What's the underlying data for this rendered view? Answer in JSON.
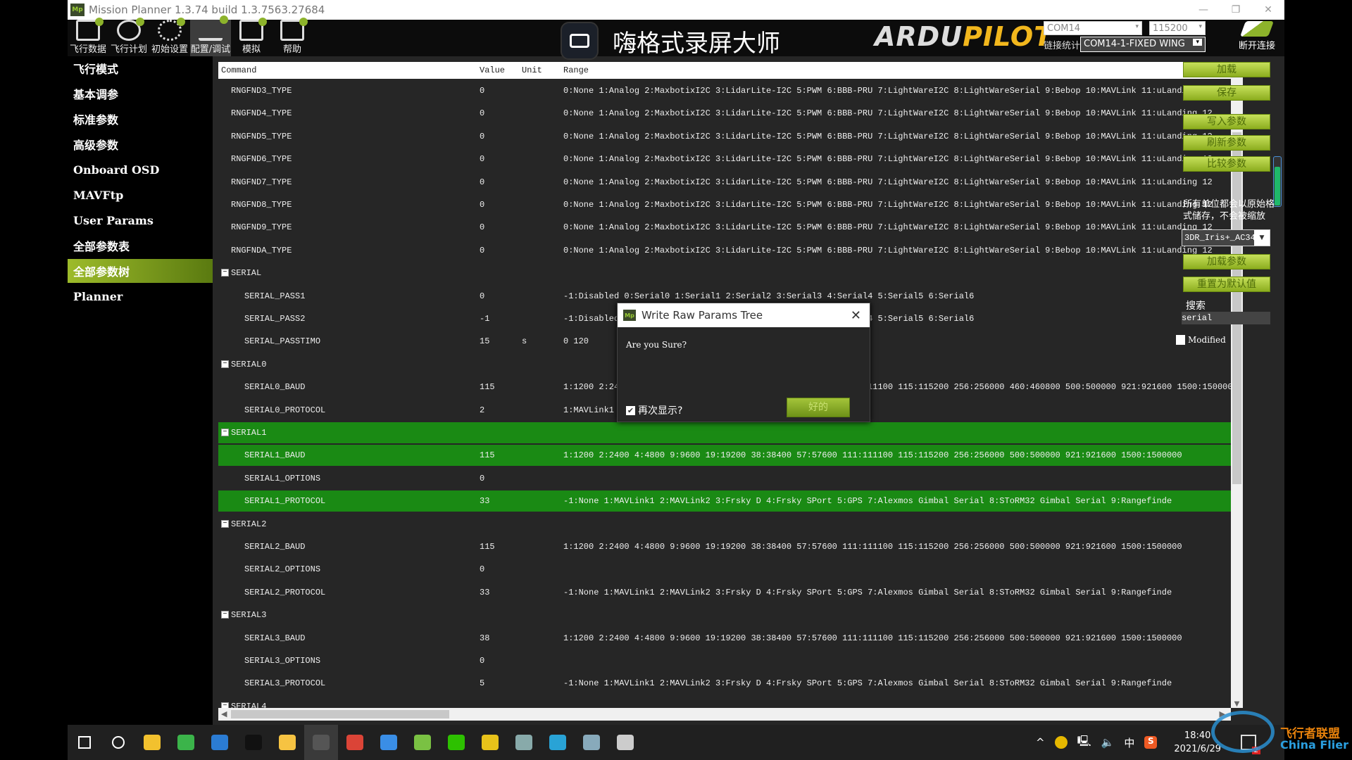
{
  "window": {
    "title": "Mission Planner 1.3.74 build 1.3.7563.27684",
    "logo": "Mp"
  },
  "toolbar": {
    "items": [
      {
        "label": "飞行数据",
        "icon": "flight-data-icon"
      },
      {
        "label": "飞行计划",
        "icon": "flight-plan-icon"
      },
      {
        "label": "初始设置",
        "icon": "initial-setup-icon"
      },
      {
        "label": "配置/调试",
        "icon": "config-tuning-icon",
        "selected": true
      },
      {
        "label": "模拟",
        "icon": "simulation-icon"
      },
      {
        "label": "帮助",
        "icon": "help-icon"
      }
    ],
    "recorder_overlay": "嗨格式录屏大师",
    "logo_ardu": "ARDU",
    "logo_pilot": "PILOT",
    "port": "COM14",
    "baud": "115200",
    "link_stats": "链接统计",
    "connection": "COM14-1-FIXED WING",
    "disconnect": "断开连接"
  },
  "sidebar": {
    "items": [
      {
        "label": "飞行模式"
      },
      {
        "label": "基本调参"
      },
      {
        "label": "标准参数"
      },
      {
        "label": "高级参数"
      },
      {
        "label": "Onboard OSD"
      },
      {
        "label": "MAVFtp"
      },
      {
        "label": "User Params"
      },
      {
        "label": "全部参数表"
      },
      {
        "label": "全部参数树",
        "active": true
      },
      {
        "label": "Planner"
      }
    ]
  },
  "grid": {
    "columns": [
      "Command",
      "Value",
      "Unit",
      "Range"
    ],
    "highlight_color": "#1a8a14",
    "rows": [
      {
        "level": 1,
        "name": "RNGFND3_TYPE",
        "value": "0",
        "unit": "",
        "range": "0:None 1:Analog 2:MaxbotixI2C 3:LidarLite-I2C 5:PWM 6:BBB-PRU 7:LightWareI2C 8:LightWareSerial 9:Bebop 10:MAVLink 11:uLanding 12"
      },
      {
        "level": 1,
        "name": "RNGFND4_TYPE",
        "value": "0",
        "unit": "",
        "range": "0:None 1:Analog 2:MaxbotixI2C 3:LidarLite-I2C 5:PWM 6:BBB-PRU 7:LightWareI2C 8:LightWareSerial 9:Bebop 10:MAVLink 11:uLanding 12"
      },
      {
        "level": 1,
        "name": "RNGFND5_TYPE",
        "value": "0",
        "unit": "",
        "range": "0:None 1:Analog 2:MaxbotixI2C 3:LidarLite-I2C 5:PWM 6:BBB-PRU 7:LightWareI2C 8:LightWareSerial 9:Bebop 10:MAVLink 11:uLanding 12"
      },
      {
        "level": 1,
        "name": "RNGFND6_TYPE",
        "value": "0",
        "unit": "",
        "range": "0:None 1:Analog 2:MaxbotixI2C 3:LidarLite-I2C 5:PWM 6:BBB-PRU 7:LightWareI2C 8:LightWareSerial 9:Bebop 10:MAVLink 11:uLanding 12"
      },
      {
        "level": 1,
        "name": "RNGFND7_TYPE",
        "value": "0",
        "unit": "",
        "range": "0:None 1:Analog 2:MaxbotixI2C 3:LidarLite-I2C 5:PWM 6:BBB-PRU 7:LightWareI2C 8:LightWareSerial 9:Bebop 10:MAVLink 11:uLanding 12"
      },
      {
        "level": 1,
        "name": "RNGFND8_TYPE",
        "value": "0",
        "unit": "",
        "range": "0:None 1:Analog 2:MaxbotixI2C 3:LidarLite-I2C 5:PWM 6:BBB-PRU 7:LightWareI2C 8:LightWareSerial 9:Bebop 10:MAVLink 11:uLanding 12"
      },
      {
        "level": 1,
        "name": "RNGFND9_TYPE",
        "value": "0",
        "unit": "",
        "range": "0:None 1:Analog 2:MaxbotixI2C 3:LidarLite-I2C 5:PWM 6:BBB-PRU 7:LightWareI2C 8:LightWareSerial 9:Bebop 10:MAVLink 11:uLanding 12"
      },
      {
        "level": 1,
        "name": "RNGFNDA_TYPE",
        "value": "0",
        "unit": "",
        "range": "0:None 1:Analog 2:MaxbotixI2C 3:LidarLite-I2C 5:PWM 6:BBB-PRU 7:LightWareI2C 8:LightWareSerial 9:Bebop 10:MAVLink 11:uLanding 12"
      },
      {
        "level": 0,
        "group": true,
        "name": "SERIAL"
      },
      {
        "level": 2,
        "name": "SERIAL_PASS1",
        "value": "0",
        "unit": "",
        "range": "-1:Disabled 0:Serial0 1:Serial1 2:Serial2 3:Serial3 4:Serial4 5:Serial5 6:Serial6"
      },
      {
        "level": 2,
        "name": "SERIAL_PASS2",
        "value": "-1",
        "unit": "",
        "range": "-1:Disabled 0:Serial0 1:Serial1 2:Serial2 3:Serial3 4:Serial4 5:Serial5 6:Serial6"
      },
      {
        "level": 2,
        "name": "SERIAL_PASSTIMO",
        "value": "15",
        "unit": "s",
        "range": "0 120"
      },
      {
        "level": 0,
        "group": true,
        "name": "SERIAL0"
      },
      {
        "level": 2,
        "name": "SERIAL0_BAUD",
        "value": "115",
        "unit": "",
        "range": "1:1200 2:2400 4:4800 9:9600 19:19200 38:38400 57:57600 111:111100 115:115200 256:256000 460:460800 500:500000 921:921600 1500:1500000"
      },
      {
        "level": 2,
        "name": "SERIAL0_PROTOCOL",
        "value": "2",
        "unit": "",
        "range": "1:MAVLink1"
      },
      {
        "level": 0,
        "group": true,
        "name": "SERIAL1",
        "highlight": true
      },
      {
        "level": 2,
        "name": "SERIAL1_BAUD",
        "value": "115",
        "unit": "",
        "range": "1:1200 2:2400 4:4800 9:9600 19:19200 38:38400 57:57600 111:111100 115:115200 256:256000 500:500000 921:921600 1500:1500000",
        "highlight": true
      },
      {
        "level": 2,
        "name": "SERIAL1_OPTIONS",
        "value": "0",
        "unit": "",
        "range": ""
      },
      {
        "level": 2,
        "name": "SERIAL1_PROTOCOL",
        "value": "33",
        "unit": "",
        "range": "-1:None  1:MAVLink1  2:MAVLink2  3:Frsky D  4:Frsky SPort  5:GPS  7:Alexmos Gimbal Serial  8:SToRM32 Gimbal Serial  9:Rangefinde",
        "highlight": true
      },
      {
        "level": 0,
        "group": true,
        "name": "SERIAL2"
      },
      {
        "level": 2,
        "name": "SERIAL2_BAUD",
        "value": "115",
        "unit": "",
        "range": "1:1200 2:2400 4:4800 9:9600 19:19200 38:38400 57:57600 111:111100 115:115200 256:256000 500:500000 921:921600 1500:1500000"
      },
      {
        "level": 2,
        "name": "SERIAL2_OPTIONS",
        "value": "0",
        "unit": "",
        "range": ""
      },
      {
        "level": 2,
        "name": "SERIAL2_PROTOCOL",
        "value": "33",
        "unit": "",
        "range": "-1:None  1:MAVLink1  2:MAVLink2  3:Frsky D  4:Frsky SPort  5:GPS  7:Alexmos Gimbal Serial  8:SToRM32 Gimbal Serial  9:Rangefinde"
      },
      {
        "level": 0,
        "group": true,
        "name": "SERIAL3"
      },
      {
        "level": 2,
        "name": "SERIAL3_BAUD",
        "value": "38",
        "unit": "",
        "range": "1:1200 2:2400 4:4800 9:9600 19:19200 38:38400 57:57600 111:111100 115:115200 256:256000 500:500000 921:921600 1500:1500000"
      },
      {
        "level": 2,
        "name": "SERIAL3_OPTIONS",
        "value": "0",
        "unit": "",
        "range": ""
      },
      {
        "level": 2,
        "name": "SERIAL3_PROTOCOL",
        "value": "5",
        "unit": "",
        "range": "-1:None  1:MAVLink1  2:MAVLink2  3:Frsky D  4:Frsky SPort  5:GPS  7:Alexmos Gimbal Serial  8:SToRM32 Gimbal Serial  9:Rangefinde"
      },
      {
        "level": 0,
        "group": true,
        "name": "SERIAL4"
      }
    ]
  },
  "right_panel": {
    "load": "加载",
    "save": "保存",
    "write": "写入参数",
    "refresh": "刷新参数",
    "compare": "比较参数",
    "note": "所有单位都会以原始格式储存，不会被缩放",
    "preset": "3DR_Iris+_AC34",
    "load_params": "加载参数",
    "reset_default": "重置为默认值",
    "search_label": "搜索",
    "search_value": "serial",
    "modified_label": "Modified",
    "modified_checked": false
  },
  "dialog": {
    "title": "Write Raw Params Tree",
    "message": "Are you Sure?",
    "checkbox_label": "再次显示?",
    "checkbox_checked": true,
    "ok": "好的"
  },
  "taskbar": {
    "apps": [
      "windows-start-icon",
      "search-icon",
      "file-explorer-icon",
      "green-app-icon",
      "word-icon",
      "qq-icon",
      "notes-icon",
      "mission-planner-icon",
      "chrome-icon",
      "blue-app-icon",
      "cube-app-icon",
      "wechat-icon",
      "yellow-app-icon",
      "3d-app-icon",
      "blue-tool-icon",
      "screenshot-app-icon",
      "recorder-icon"
    ],
    "tray_ime": "中",
    "time": "18:40",
    "date": "2021/6/29",
    "notification_count": "2"
  },
  "watermark": {
    "cn": "飞行者联盟",
    "en": "China Flier"
  }
}
